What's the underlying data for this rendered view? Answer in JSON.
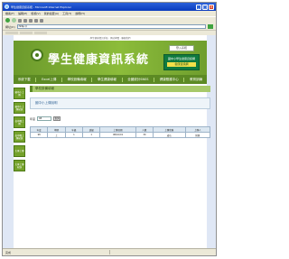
{
  "window": {
    "title": "學生健康資訊系統 - Microsoft Internet Explorer",
    "minimize": "_",
    "maximize": "□",
    "close": "×"
  },
  "menubar": [
    "檔案(F)",
    "編輯(E)",
    "檢視(V)",
    "我的最愛(A)",
    "工具(T)",
    "說明(H)"
  ],
  "address": {
    "label": "網址(D)",
    "url": "http://"
  },
  "site": {
    "toplinks": "學生健康資訊系統 ‧ 網站導覽 ‧ 聯絡我們",
    "title": "學生健康資訊系統",
    "login_label": "登入系統",
    "promo": {
      "top": "國中小學生健康資訊網",
      "mid": "健康資訊網"
    },
    "nav": [
      "系統下載",
      "Excel上傳",
      "學校設備填報",
      "學生健康填報",
      "全國統計SNSS",
      "健康照護中心",
      "教育訓練"
    ],
    "sidebar": [
      "國中小上傳",
      "國中小上傳紀錄",
      "高中職上傳",
      "高中職上傳紀錄",
      "大專上傳",
      "大專上傳紀錄"
    ],
    "breadcrumb": "學校設備填報",
    "panel_title": "國中小上傳說明",
    "query": {
      "label": "年度",
      "select_value": "98",
      "button": "查詢"
    },
    "table": {
      "headers": [
        "年度",
        "學期",
        "年級",
        "班級",
        "上傳日期",
        "人數",
        "上傳狀態",
        "上傳人"
      ],
      "rows": [
        [
          "98",
          "上",
          "1",
          "1",
          "98/10/01",
          "30",
          "成功",
          "管理"
        ]
      ]
    }
  },
  "status": {
    "text": "完成"
  }
}
